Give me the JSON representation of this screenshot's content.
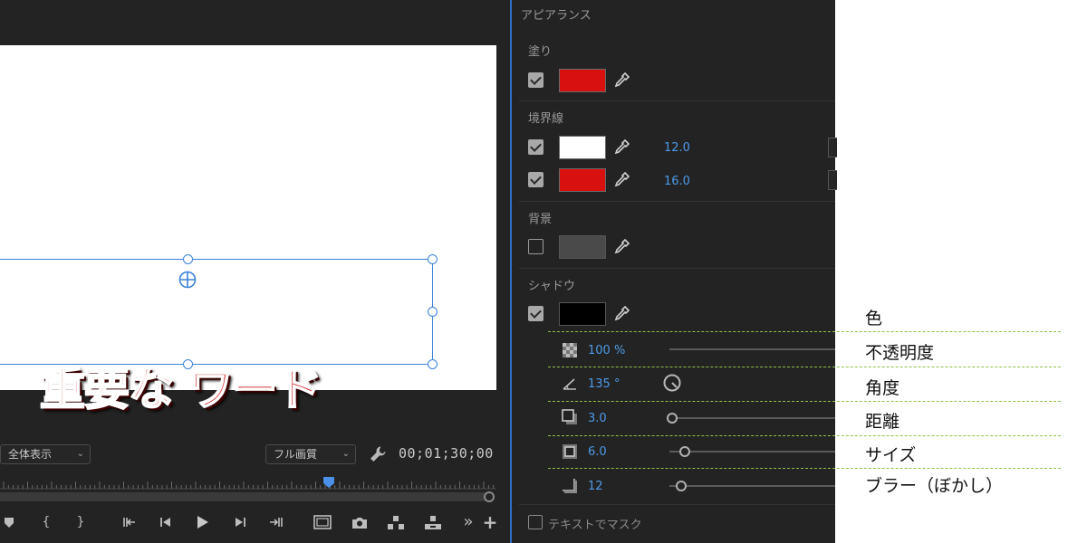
{
  "monitor": {
    "title_text": "重要な ワード",
    "zoom_select": "全体表示",
    "quality_select": "フル画質",
    "timecode": "00;01;30;00",
    "transport_icons": [
      "marker-icon",
      "in-point-icon",
      "out-point-icon",
      "go-to-in-icon",
      "step-back-icon",
      "play-icon",
      "step-forward-icon",
      "go-to-out-icon",
      "safe-margins-icon",
      "export-frame-icon",
      "lift-icon",
      "extract-icon",
      "more-icon",
      "add-button-icon"
    ],
    "transport_glyphs": {
      "in": "{",
      "out": "}",
      "more": "»",
      "add": "+"
    }
  },
  "panel": {
    "header": "アピアランス",
    "fill": {
      "label": "塗り",
      "checked": true,
      "color": "#d91010"
    },
    "stroke": {
      "label": "境界線",
      "items": [
        {
          "checked": true,
          "color": "#ffffff",
          "width": "12.0"
        },
        {
          "checked": true,
          "color": "#d91010",
          "width": "16.0"
        }
      ]
    },
    "background": {
      "label": "背景",
      "checked": false,
      "color": "#4a4a4a"
    },
    "shadow": {
      "label": "シャドウ",
      "checked": true,
      "color": "#000000",
      "opacity": "100 %",
      "angle": "135 °",
      "distance": "3.0",
      "size": "6.0",
      "blur": "12"
    },
    "text_mask_label": "テキストでマスク"
  },
  "annotations": {
    "color": "色",
    "opacity": "不透明度",
    "angle": "角度",
    "distance": "距離",
    "size": "サイズ",
    "blur": "ブラー（ぼかし）"
  }
}
